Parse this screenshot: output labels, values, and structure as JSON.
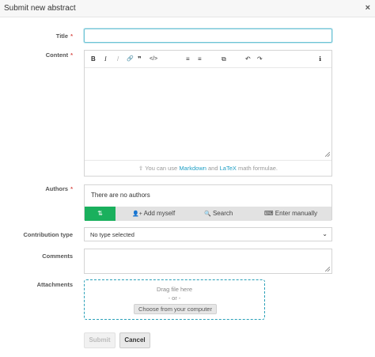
{
  "dialog": {
    "title": "Submit new abstract",
    "close": "×"
  },
  "fields": {
    "title_label": "Title",
    "content_label": "Content",
    "authors_label": "Authors",
    "contribution_label": "Contribution type",
    "comments_label": "Comments",
    "attachments_label": "Attachments",
    "required_mark": "*"
  },
  "title_input": {
    "value": ""
  },
  "editor": {
    "toolbar": {
      "bold": "B",
      "italic": "I",
      "strike": "/",
      "link": "🔗",
      "quote": "❞",
      "code": "</>",
      "ordered_list": "≡",
      "unordered_list": "≡",
      "preview": "⧉",
      "undo": "↶",
      "redo": "↷",
      "info": "ℹ"
    },
    "hint": {
      "icon": "⇧",
      "prefix": "You can use",
      "markdown": "Markdown",
      "and": "and",
      "latex": "LaTeX",
      "suffix": "math formulae."
    }
  },
  "authors": {
    "empty_text": "There are no authors",
    "sort_icon": "⇅",
    "add_myself": "Add myself",
    "search": "Search",
    "enter_manually": "Enter manually",
    "icons": {
      "add_user": "👤+",
      "search": "🔍",
      "keyboard": "⌨"
    }
  },
  "contribution_type": {
    "selected": "No type selected"
  },
  "attachments": {
    "drag_text": "Drag file here",
    "or_text": "- or -",
    "choose_label": "Choose from your computer"
  },
  "actions": {
    "submit_label": "Submit",
    "cancel_label": "Cancel"
  },
  "colors": {
    "accent": "#1ab05d",
    "link": "#1f9fc5",
    "focus": "#6cc3d5",
    "required": "#d9534f"
  }
}
